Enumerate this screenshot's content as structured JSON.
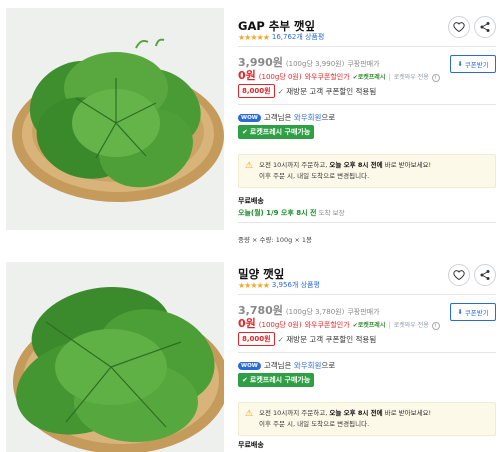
{
  "products": [
    {
      "title": "GAP 추부 깻잎",
      "stars": "★★★★★",
      "review_count": "16,762개 상품평",
      "price": "3,990원",
      "unit_price": "(100g당 3,990원)",
      "price_tag": "쿠팡판매가",
      "coupon_price": "0원",
      "coupon_unit": "(100g당 0원)",
      "coupon_label": "와우쿠폰할인가",
      "rocket_fresh": "로켓프레시",
      "separator": "|",
      "rocket_wow": "로켓와우 전용",
      "info_icon": "i",
      "coupon_button_icon": "coupon-download-icon",
      "coupon_button": "쿠폰받기",
      "discount_badge": "8,000원",
      "discount_text": "재방문 고객 쿠폰할인 적용됨",
      "wow_badge": "WOW",
      "wow_text": "고객님은",
      "wow_link": "와우회원",
      "wow_suffix": "으로",
      "rocket_button": "로켓프레시 구매가능",
      "notice_line1_a": "오전 10시까지 주문하고,",
      "notice_line1_b": "오늘 오후 8시 전에",
      "notice_line1_c": "바로 받아보세요!",
      "notice_line2": "이후 주문 시, 내일 도착으로 변경됩니다.",
      "shipping_title": "무료배송",
      "shipping_date": "오늘(월) 1/9 오후 8시 전",
      "shipping_note": "도착 보장",
      "weight": "중량 × 수량: 100g × 1봉"
    },
    {
      "title": "밀양 깻잎",
      "stars": "★★★★★",
      "review_count": "3,956개 상품평",
      "price": "3,780원",
      "unit_price": "(100g당 3,780원)",
      "price_tag": "쿠팡판매가",
      "coupon_price": "0원",
      "coupon_unit": "(100g당 0원)",
      "coupon_label": "와우쿠폰할인가",
      "rocket_fresh": "로켓프레시",
      "separator": "|",
      "rocket_wow": "로켓와우 전용",
      "info_icon": "i",
      "coupon_button_icon": "coupon-download-icon",
      "coupon_button": "쿠폰받기",
      "discount_badge": "8,000원",
      "discount_text": "재방문 고객 쿠폰할인 적용됨",
      "wow_badge": "WOW",
      "wow_text": "고객님은",
      "wow_link": "와우회원",
      "wow_suffix": "으로",
      "rocket_button": "로켓프레시 구매가능",
      "notice_line1_a": "오전 10시까지 주문하고,",
      "notice_line1_b": "오늘 오후 8시 전에",
      "notice_line1_c": "바로 받아보세요!",
      "notice_line2": "이후 주문 시, 내일 도착으로 변경됩니다.",
      "shipping_title": "무료배송"
    }
  ],
  "colors": {
    "accent_red": "#e52528",
    "link_blue": "#2a6bd6",
    "rocket_green": "#2f9e44",
    "star_orange": "#f5a623"
  }
}
